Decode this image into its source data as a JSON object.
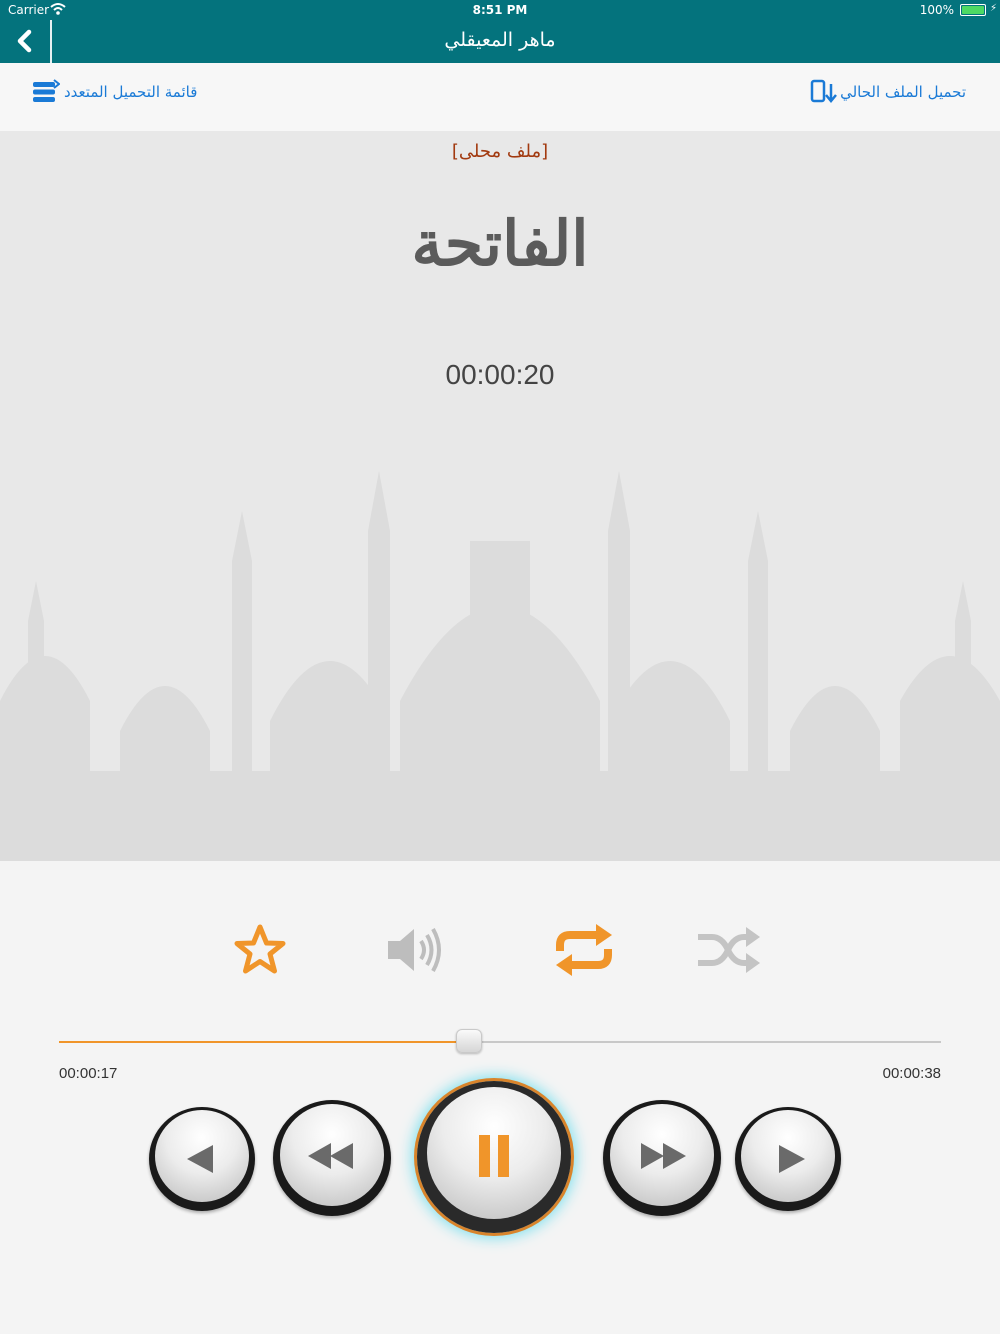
{
  "status_bar": {
    "carrier": "Carrier",
    "time": "8:51 PM",
    "battery_percent": "100%",
    "battery_color": "#4cd964"
  },
  "nav": {
    "title": "ماهر المعيقلي",
    "back_icon": "chevron-left-icon",
    "background_color": "#04737d"
  },
  "toolbar": {
    "multi_download_label": "قائمة التحميل المتعدد",
    "multi_download_icon": "stack-list-icon",
    "download_current_label": "تحميل الملف الحالي",
    "download_current_icon": "phone-download-icon",
    "link_color": "#1a7ad6"
  },
  "track": {
    "source_tag": "[ملف محلى]",
    "surah_name": "الفاتحة",
    "elapsed_display": "00:00:20"
  },
  "playback": {
    "current_time": "00:00:17",
    "total_time": "00:00:38",
    "progress_fraction": 0.465,
    "accent_color": "#f0952a",
    "favorite_icon": "star-icon",
    "volume_icon": "speaker-icon",
    "repeat_icon": "repeat-icon",
    "repeat_active": true,
    "shuffle_icon": "shuffle-icon",
    "shuffle_active": false,
    "buttons": [
      "previous-icon",
      "rewind-icon",
      "pause-icon",
      "fast-forward-icon",
      "next-icon"
    ]
  }
}
